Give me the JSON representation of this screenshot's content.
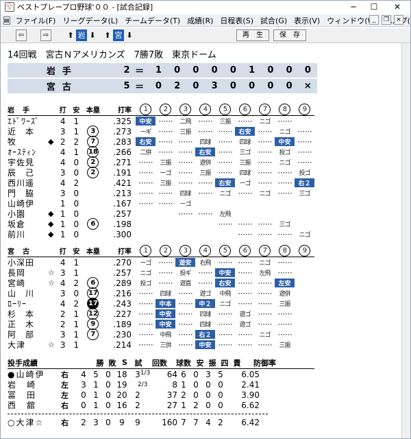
{
  "window": {
    "title": "ベストプレープロ野球'００ - [試合記録]",
    "app_icon": "baseball-glove-icon"
  },
  "menu": [
    "ファイル(F)",
    "リーグデータ(L)",
    "チームデータ(T)",
    "成績(R)",
    "日程表(S)",
    "試合(G)",
    "表示(V)",
    "ウィンドウ(W)",
    "ヘルプ(H)"
  ],
  "toolbar": {
    "team_a": "岩",
    "team_b": "宮",
    "replay": "再　生",
    "save": "保　存"
  },
  "game_header": "14回戦　宮古Ｎアメリカンズ　7勝7敗　東京ドーム",
  "scoreboard": [
    {
      "team": "岩手",
      "total": "2",
      "eq": "＝",
      "innings": [
        "1",
        "0",
        "0",
        "0",
        "0",
        "1",
        "0",
        "0",
        "0"
      ]
    },
    {
      "team": "宮古",
      "total": "5",
      "eq": "＝",
      "innings": [
        "0",
        "2",
        "0",
        "3",
        "0",
        "0",
        "0",
        "0",
        "×"
      ]
    }
  ],
  "col_headers": {
    "ab": "打",
    "h": "安",
    "hr": "本塁",
    "avg": "打率"
  },
  "innings_nums": [
    "1",
    "2",
    "3",
    "4",
    "5",
    "6",
    "7",
    "8",
    "9"
  ],
  "team1": {
    "name": "岩　手",
    "players": [
      {
        "name": "ｴﾄﾞﾜｰｽﾞ",
        "pos": "",
        "ab": "4",
        "h": "1",
        "hr": "",
        "fill": false,
        "avg": ".325",
        "cells": [
          [
            "中安",
            1
          ],
          [
            "…",
            0
          ],
          [
            "二飛",
            0
          ],
          [
            "…",
            0
          ],
          [
            "三振",
            0
          ],
          [
            "…",
            0
          ],
          [
            "ニゴ",
            0
          ],
          [
            "…",
            0
          ],
          [
            "",
            0
          ]
        ]
      },
      {
        "name": "近　本",
        "pos": "",
        "ab": "3",
        "h": "1",
        "hr": "3",
        "fill": false,
        "avg": ".273",
        "cells": [
          [
            "ーギ",
            0
          ],
          [
            "…",
            0
          ],
          [
            "三振",
            0
          ],
          [
            "…",
            0
          ],
          [
            "…",
            0
          ],
          [
            "右安",
            1
          ],
          [
            "…",
            0
          ],
          [
            "ニゴ",
            0
          ],
          [
            "…",
            0
          ]
        ]
      },
      {
        "name": "牧",
        "pos": "◆",
        "ab": "2",
        "h": "2",
        "hr": "7",
        "fill": false,
        "avg": ".283",
        "cells": [
          [
            "右安",
            1
          ],
          [
            "…",
            0
          ],
          [
            "…",
            0
          ],
          [
            "四球",
            0
          ],
          [
            "…",
            0
          ],
          [
            "四球",
            0
          ],
          [
            "…",
            0
          ],
          [
            "中安",
            1
          ],
          [
            "…",
            0
          ]
        ]
      },
      {
        "name": "ｵｰｽﾃｨﾝ",
        "pos": "",
        "ab": "4",
        "h": "1",
        "hr": "18",
        "fill": false,
        "avg": ".266",
        "cells": [
          [
            "二併",
            0
          ],
          [
            "…",
            0
          ],
          [
            "…",
            0
          ],
          [
            "右安",
            1
          ],
          [
            "…",
            0
          ],
          [
            "三ゴ",
            0
          ],
          [
            "…",
            0
          ],
          [
            "投ゴ",
            0
          ],
          [
            "…",
            0
          ]
        ]
      },
      {
        "name": "宇佐見",
        "pos": "",
        "ab": "4",
        "h": "0",
        "hr": "2",
        "fill": false,
        "avg": ".271",
        "cells": [
          [
            "…",
            0
          ],
          [
            "三振",
            0
          ],
          [
            "…",
            0
          ],
          [
            "遊併",
            0
          ],
          [
            "…",
            0
          ],
          [
            "三振",
            0
          ],
          [
            "…",
            0
          ],
          [
            "ニゴ",
            0
          ],
          [
            "…",
            0
          ]
        ]
      },
      {
        "name": "辰　己",
        "pos": "",
        "ab": "3",
        "h": "0",
        "hr": "2",
        "fill": false,
        "avg": ".191",
        "cells": [
          [
            "…",
            0
          ],
          [
            "ーゴ",
            0
          ],
          [
            "…",
            0
          ],
          [
            "三振",
            0
          ],
          [
            "…",
            0
          ],
          [
            "四球",
            0
          ],
          [
            "…",
            0
          ],
          [
            "…",
            0
          ],
          [
            "投ゴ",
            0
          ]
        ]
      },
      {
        "name": "西川遥",
        "pos": "",
        "ab": "4",
        "h": "2",
        "hr": "",
        "fill": false,
        "avg": ".421",
        "cells": [
          [
            "…",
            0
          ],
          [
            "三振",
            0
          ],
          [
            "…",
            0
          ],
          [
            "…",
            0
          ],
          [
            "右安",
            1
          ],
          [
            "ーゴ",
            0
          ],
          [
            "…",
            0
          ],
          [
            "…",
            0
          ],
          [
            "右２",
            1
          ]
        ]
      },
      {
        "name": "門　脇",
        "pos": "",
        "ab": "3",
        "h": "0",
        "hr": "",
        "fill": false,
        "avg": ".213",
        "cells": [
          [
            "…",
            0
          ],
          [
            "…",
            0
          ],
          [
            "四球",
            0
          ],
          [
            "…",
            0
          ],
          [
            "ニゴ",
            0
          ],
          [
            "…",
            0
          ],
          [
            "ニゴ",
            0
          ],
          [
            "…",
            0
          ],
          [
            "三ゴ",
            0
          ]
        ]
      },
      {
        "name": "山崎伊",
        "pos": "",
        "ab": "1",
        "h": "0",
        "hr": "",
        "fill": false,
        "avg": ".167",
        "cells": [
          [
            "…",
            0
          ],
          [
            "…",
            0
          ],
          [
            "ーゴ",
            0
          ],
          [
            "",
            0
          ],
          [
            "",
            0
          ],
          [
            "",
            0
          ],
          [
            "",
            0
          ],
          [
            "",
            0
          ],
          [
            "",
            0
          ]
        ]
      },
      {
        "name": "小園",
        "pos": "◆",
        "ab": "1",
        "h": "0",
        "hr": "",
        "fill": false,
        "avg": ".257",
        "cells": [
          [
            "",
            0
          ],
          [
            "",
            0
          ],
          [
            "…",
            0
          ],
          [
            "…",
            0
          ],
          [
            "左飛",
            0
          ],
          [
            "",
            0
          ],
          [
            "",
            0
          ],
          [
            "",
            0
          ],
          [
            "",
            0
          ]
        ]
      },
      {
        "name": "坂倉",
        "pos": "◆",
        "ab": "1",
        "h": "0",
        "hr": "6",
        "fill": false,
        "avg": ".198",
        "cells": [
          [
            "",
            0
          ],
          [
            "",
            0
          ],
          [
            "",
            0
          ],
          [
            "",
            0
          ],
          [
            "…",
            0
          ],
          [
            "…",
            0
          ],
          [
            "…",
            0
          ],
          [
            "三ゴ",
            0
          ],
          [
            "",
            0
          ]
        ]
      },
      {
        "name": "前川",
        "pos": "◆",
        "ab": "1",
        "h": "0",
        "hr": "",
        "fill": false,
        "avg": ".300",
        "cells": [
          [
            "",
            0
          ],
          [
            "",
            0
          ],
          [
            "",
            0
          ],
          [
            "",
            0
          ],
          [
            "",
            0
          ],
          [
            "…",
            0
          ],
          [
            "…",
            0
          ],
          [
            "…",
            0
          ],
          [
            "ニゴ",
            0
          ]
        ]
      }
    ]
  },
  "team2": {
    "name": "宮　古",
    "players": [
      {
        "name": "小深田",
        "pos": "",
        "ab": "4",
        "h": "1",
        "hr": "",
        "fill": false,
        "avg": ".270",
        "cells": [
          [
            "ーゴ",
            0
          ],
          [
            "…",
            0
          ],
          [
            "遊安",
            1
          ],
          [
            "右飛",
            0
          ],
          [
            "…",
            0
          ],
          [
            "…",
            0
          ],
          [
            "ニゴ",
            0
          ],
          [
            "…",
            0
          ],
          [
            "",
            0
          ]
        ]
      },
      {
        "name": "長岡",
        "pos": "☆",
        "ab": "3",
        "h": "1",
        "hr": "",
        "fill": false,
        "avg": ".257",
        "cells": [
          [
            "ニゴ",
            0
          ],
          [
            "…",
            0
          ],
          [
            "投ギ",
            0
          ],
          [
            "…",
            0
          ],
          [
            "中安",
            1
          ],
          [
            "…",
            0
          ],
          [
            "左飛",
            0
          ],
          [
            "…",
            0
          ],
          [
            "",
            0
          ]
        ]
      },
      {
        "name": "宮崎",
        "pos": "☆",
        "ab": "4",
        "h": "2",
        "hr": "6",
        "fill": false,
        "avg": ".289",
        "cells": [
          [
            "投ゴ",
            0
          ],
          [
            "…",
            0
          ],
          [
            "遊直",
            0
          ],
          [
            "…",
            0
          ],
          [
            "右安",
            1
          ],
          [
            "…",
            0
          ],
          [
            "…",
            0
          ],
          [
            "左安",
            1
          ],
          [
            "",
            0
          ]
        ]
      },
      {
        "name": "山　川",
        "pos": "",
        "ab": "3",
        "h": "0",
        "hr": "17",
        "fill": false,
        "avg": ".216",
        "cells": [
          [
            "…",
            0
          ],
          [
            "四球",
            0
          ],
          [
            "…",
            0
          ],
          [
            "遊ゴ",
            0
          ],
          [
            "中飛",
            0
          ],
          [
            "…",
            0
          ],
          [
            "…",
            0
          ],
          [
            "遊併",
            0
          ],
          [
            "",
            0
          ]
        ]
      },
      {
        "name": "ﾛｰﾘｰ",
        "pos": "",
        "ab": "4",
        "h": "2",
        "hr": "17",
        "fill": true,
        "avg": ".243",
        "cells": [
          [
            "…",
            0
          ],
          [
            "中本",
            1
          ],
          [
            "…",
            0
          ],
          [
            "中２",
            1
          ],
          [
            "ニゴ",
            0
          ],
          [
            "…",
            0
          ],
          [
            "…",
            0
          ],
          [
            "三振",
            0
          ],
          [
            "",
            0
          ]
        ]
      },
      {
        "name": "杉　本",
        "pos": "",
        "ab": "2",
        "h": "1",
        "hr": "12",
        "fill": false,
        "avg": ".227",
        "cells": [
          [
            "…",
            0
          ],
          [
            "中安",
            1
          ],
          [
            "…",
            0
          ],
          [
            "四球",
            0
          ],
          [
            "…",
            0
          ],
          [
            "遊ゴ",
            0
          ],
          [
            "…",
            0
          ],
          [
            "…",
            0
          ],
          [
            "",
            0
          ]
        ]
      },
      {
        "name": "正　木",
        "pos": "",
        "ab": "2",
        "h": "1",
        "hr": "9",
        "fill": false,
        "avg": ".189",
        "cells": [
          [
            "…",
            0
          ],
          [
            "中安",
            1
          ],
          [
            "…",
            0
          ],
          [
            "四球",
            0
          ],
          [
            "…",
            0
          ],
          [
            "遊ゴ",
            0
          ],
          [
            "…",
            0
          ],
          [
            "…",
            0
          ],
          [
            "",
            0
          ]
        ]
      },
      {
        "name": "阿　部",
        "pos": "",
        "ab": "3",
        "h": "1",
        "hr": "7",
        "fill": false,
        "avg": ".230",
        "cells": [
          [
            "…",
            0
          ],
          [
            "中飛",
            0
          ],
          [
            "…",
            0
          ],
          [
            "右２",
            1
          ],
          [
            "…",
            0
          ],
          [
            "…",
            0
          ],
          [
            "ニゴ",
            0
          ],
          [
            "…",
            0
          ],
          [
            "",
            0
          ]
        ]
      },
      {
        "name": "大津",
        "pos": "☆",
        "ab": "3",
        "h": "1",
        "hr": "",
        "fill": false,
        "avg": ".214",
        "cells": [
          [
            "…",
            0
          ],
          [
            "三併",
            0
          ],
          [
            "…",
            0
          ],
          [
            "中安",
            1
          ],
          [
            "…",
            0
          ],
          [
            "…",
            0
          ],
          [
            "…",
            0
          ],
          [
            "三振",
            0
          ],
          [
            "",
            0
          ]
        ]
      }
    ]
  },
  "pitching": {
    "title": "投手成績",
    "headers": [
      "勝",
      "敗",
      "S",
      "試",
      "回数",
      "球数",
      "安",
      "振",
      "四",
      "責",
      "防御率"
    ],
    "team1": [
      {
        "mark": "●",
        "name": "山崎伊",
        "side": "右",
        "w": "4",
        "l": "5",
        "s": "0",
        "g": "18",
        "ip": "3",
        "ipf": "1/3",
        "np": "64",
        "h": "6",
        "k": "0",
        "bb": "3",
        "er": "5",
        "era": "6.05"
      },
      {
        "mark": "",
        "name": "岩　崎",
        "side": "左",
        "w": "3",
        "l": "1",
        "s": "0",
        "g": "19",
        "ip": "",
        "ipf": "2/3",
        "np": "8",
        "h": "1",
        "k": "0",
        "bb": "0",
        "er": "0",
        "era": "2.41"
      },
      {
        "mark": "",
        "name": "冨　田",
        "side": "左",
        "w": "0",
        "l": "1",
        "s": "0",
        "g": "20",
        "ip": "2",
        "ipf": "",
        "np": "37",
        "h": "2",
        "k": "0",
        "bb": "0",
        "er": "0",
        "era": "3.90"
      },
      {
        "mark": "",
        "name": "西　舘",
        "side": "右",
        "w": "0",
        "l": "1",
        "s": "0",
        "g": "16",
        "ip": "2",
        "ipf": "",
        "np": "27",
        "h": "1",
        "k": "2",
        "bb": "0",
        "er": "0",
        "era": "6.62"
      }
    ],
    "team2": [
      {
        "mark": "○",
        "name": "大津☆",
        "side": "右",
        "w": "2",
        "l": "3",
        "s": "0",
        "g": "9",
        "ip": "9",
        "ipf": "",
        "np": "160",
        "h": "7",
        "k": "7",
        "bb": "4",
        "er": "2",
        "era": "6.42"
      }
    ]
  }
}
